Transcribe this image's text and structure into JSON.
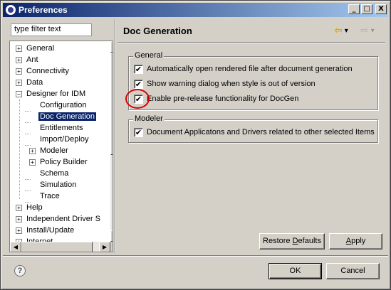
{
  "window": {
    "title": "Preferences",
    "minimize_glyph": "_",
    "maximize_glyph": "□",
    "close_glyph": "X"
  },
  "filter": {
    "placeholder": "type filter text",
    "value": "type filter text"
  },
  "tree": {
    "items": [
      {
        "label": "General",
        "expander": "+",
        "level": 0
      },
      {
        "label": "Ant",
        "expander": "+",
        "level": 0
      },
      {
        "label": "Connectivity",
        "expander": "+",
        "level": 0
      },
      {
        "label": "Data",
        "expander": "+",
        "level": 0
      },
      {
        "label": "Designer for IDM",
        "expander": "−",
        "level": 0
      },
      {
        "label": "Configuration",
        "expander": "",
        "level": 1
      },
      {
        "label": "Doc Generation",
        "expander": "",
        "level": 1,
        "selected": true
      },
      {
        "label": "Entitlements",
        "expander": "",
        "level": 1
      },
      {
        "label": "Import/Deploy",
        "expander": "",
        "level": 1
      },
      {
        "label": "Modeler",
        "expander": "+",
        "level": 1
      },
      {
        "label": "Policy Builder",
        "expander": "+",
        "level": 1
      },
      {
        "label": "Schema",
        "expander": "",
        "level": 1
      },
      {
        "label": "Simulation",
        "expander": "",
        "level": 1
      },
      {
        "label": "Trace",
        "expander": "",
        "level": 1
      },
      {
        "label": "Help",
        "expander": "+",
        "level": 0
      },
      {
        "label": "Independent Driver S",
        "expander": "+",
        "level": 0
      },
      {
        "label": "Install/Update",
        "expander": "+",
        "level": 0
      },
      {
        "label": "Internet",
        "expander": "+",
        "level": 0
      }
    ],
    "scroll_up_glyph": "▲",
    "scroll_down_glyph": "▼",
    "scroll_left_glyph": "◀",
    "scroll_right_glyph": "▶"
  },
  "page": {
    "title": "Doc Generation",
    "back_icon": "back-arrow-icon",
    "forward_icon": "forward-arrow-icon",
    "back_glyph": "⇦",
    "forward_glyph": "⇨",
    "dropdown_glyph": "▾"
  },
  "general_group": {
    "legend": "General",
    "options": [
      {
        "label": "Automatically open rendered file after document generation",
        "checked": true
      },
      {
        "label": "Show warning dialog when style is out of version",
        "checked": true
      },
      {
        "label": "Enable pre-release functionality for DocGen",
        "checked": true
      }
    ]
  },
  "modeler_group": {
    "legend": "Modeler",
    "options": [
      {
        "label": "Document Applicatons and Drivers related to other selected Items",
        "checked": true
      }
    ]
  },
  "buttons": {
    "restore_defaults": {
      "pre": "Restore ",
      "mnemonic": "D",
      "post": "efaults"
    },
    "apply": {
      "pre": "",
      "mnemonic": "A",
      "post": "pply"
    },
    "ok": "OK",
    "cancel": "Cancel"
  },
  "help_glyph": "?",
  "check_glyph": "✔",
  "colors": {
    "title_bar": "#0a246a",
    "selection": "#0a246a",
    "face": "#d4d0c8",
    "annotation_circle": "#d80000",
    "nav_arrow": "#e0a800"
  }
}
